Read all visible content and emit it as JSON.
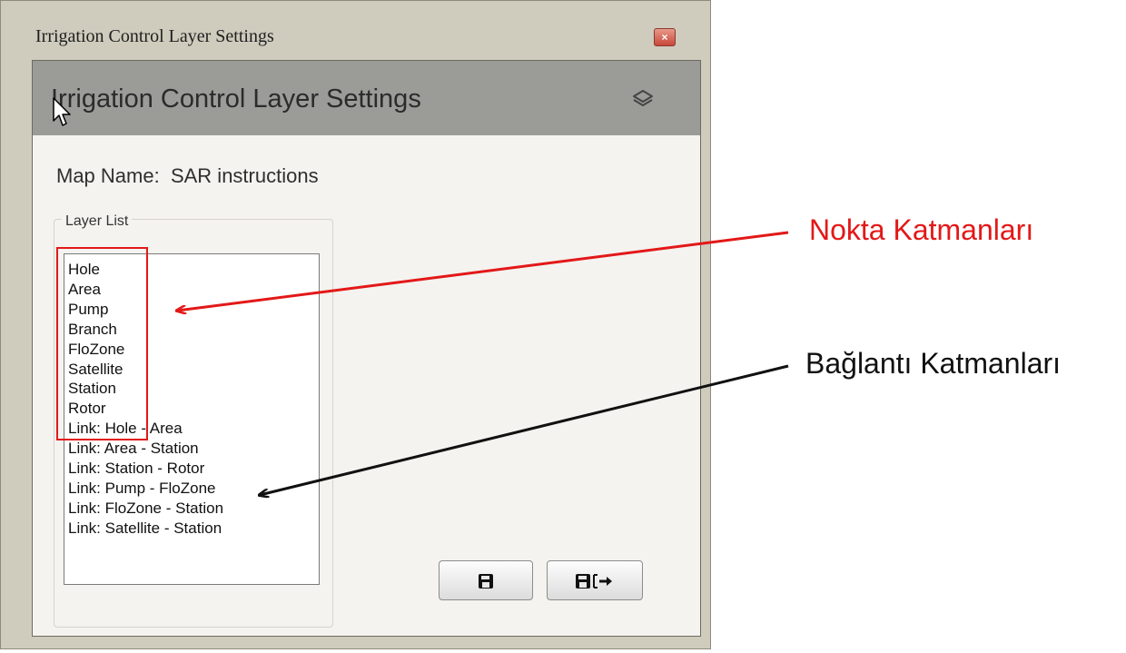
{
  "window": {
    "title": "Irrigation Control Layer Settings",
    "close_symbol": "×"
  },
  "header": {
    "title": "Irrigation Control Layer Settings",
    "icon": "layers-icon"
  },
  "map": {
    "label": "Map Name:",
    "value": "SAR instructions"
  },
  "layer_list": {
    "label": "Layer List",
    "items": [
      "Hole",
      "Area",
      "Pump",
      "Branch",
      "FloZone",
      "Satellite",
      "Station",
      "Rotor",
      "Link: Hole - Area",
      "Link: Area - Station",
      "Link: Station - Rotor",
      "Link: Pump - FloZone",
      "Link: FloZone - Station",
      "Link: Satellite - Station"
    ]
  },
  "buttons": {
    "save_icon": "save-icon",
    "save_exit_icon": "save-exit-icon"
  },
  "annotations": {
    "point_layers": "Nokta Katmanları",
    "link_layers": "Bağlantı Katmanları",
    "highlight_color": "#e31818",
    "arrow_black_color": "#111111"
  }
}
